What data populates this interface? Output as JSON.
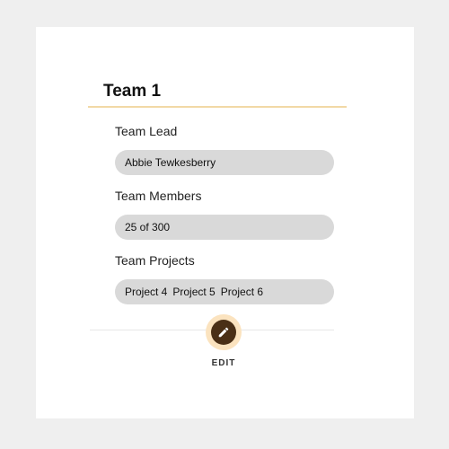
{
  "team": {
    "title": "Team 1",
    "lead": {
      "label": "Team Lead",
      "value": "Abbie Tewkesberry"
    },
    "members": {
      "label": "Team Members",
      "value": "25 of 300"
    },
    "projects": {
      "label": "Team Projects",
      "items": [
        "Project 4",
        "Project 5",
        "Project 6"
      ]
    }
  },
  "actions": {
    "edit_label": "EDIT",
    "edit_icon": "pencil-icon"
  },
  "colors": {
    "accent": "#f2d9a6",
    "button_ring": "#fbe3bf",
    "button_fill": "#4a2f16",
    "pill_background": "#d9d9d9"
  }
}
